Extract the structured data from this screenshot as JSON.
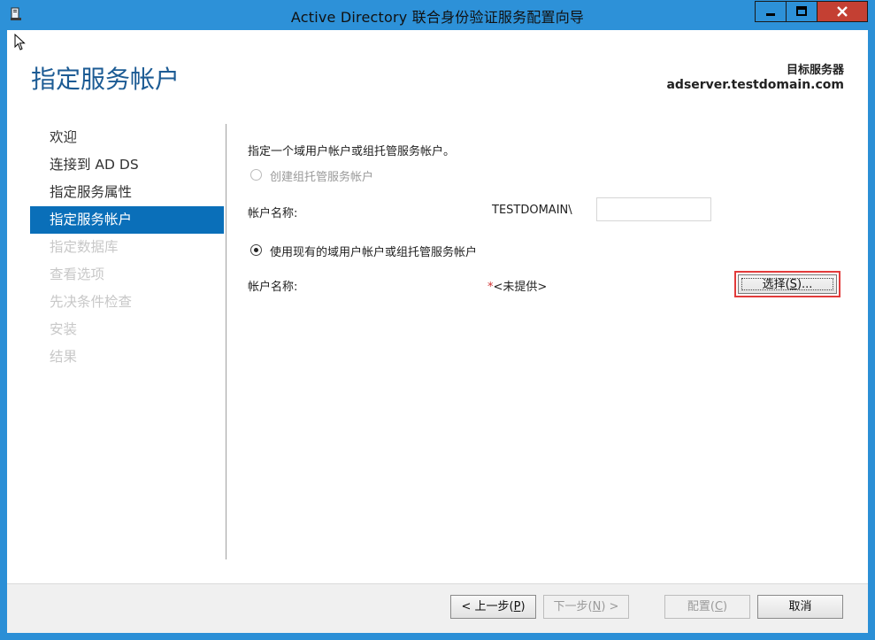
{
  "window": {
    "title": "Active Directory 联合身份验证服务配置向导",
    "controls": {
      "minimize": "minimize-icon",
      "maximize": "maximize-icon",
      "close": "close-icon"
    }
  },
  "header": {
    "page_title": "指定服务帐户",
    "target_label": "目标服务器",
    "target_server": "adserver.testdomain.com"
  },
  "nav": {
    "items": [
      {
        "label": "欢迎",
        "state": "normal"
      },
      {
        "label": "连接到 AD DS",
        "state": "normal"
      },
      {
        "label": "指定服务属性",
        "state": "normal"
      },
      {
        "label": "指定服务帐户",
        "state": "active"
      },
      {
        "label": "指定数据库",
        "state": "disabled"
      },
      {
        "label": "查看选项",
        "state": "disabled"
      },
      {
        "label": "先决条件检查",
        "state": "disabled"
      },
      {
        "label": "安装",
        "state": "disabled"
      },
      {
        "label": "结果",
        "state": "disabled"
      }
    ]
  },
  "main": {
    "instruction": "指定一个域用户帐户或组托管服务帐户。",
    "option_create": {
      "label": "创建组托管服务帐户",
      "selected": false,
      "enabled": false
    },
    "create_account_label": "帐户名称:",
    "domain_prefix": "TESTDOMAIN\\",
    "create_account_value": "",
    "option_existing": {
      "label": "使用现有的域用户帐户或组托管服务帐户",
      "selected": true,
      "enabled": true
    },
    "existing_account_label": "帐户名称:",
    "required_marker": "*",
    "existing_account_value": "<未提供>",
    "select_button": {
      "prefix": "选择(",
      "accel": "S",
      "suffix": ")..."
    }
  },
  "footer": {
    "back": {
      "prefix": "< 上一步(",
      "accel": "P",
      "suffix": ")"
    },
    "next": {
      "prefix": "下一步(",
      "accel": "N",
      "suffix": ") >"
    },
    "configure": {
      "prefix": "配置(",
      "accel": "C",
      "suffix": ")"
    },
    "cancel": "取消"
  },
  "colors": {
    "titlebar": "#2d91d8",
    "accent": "#0a6fb9",
    "page_title": "#1c5b94",
    "highlight_border": "#e23b3b"
  }
}
